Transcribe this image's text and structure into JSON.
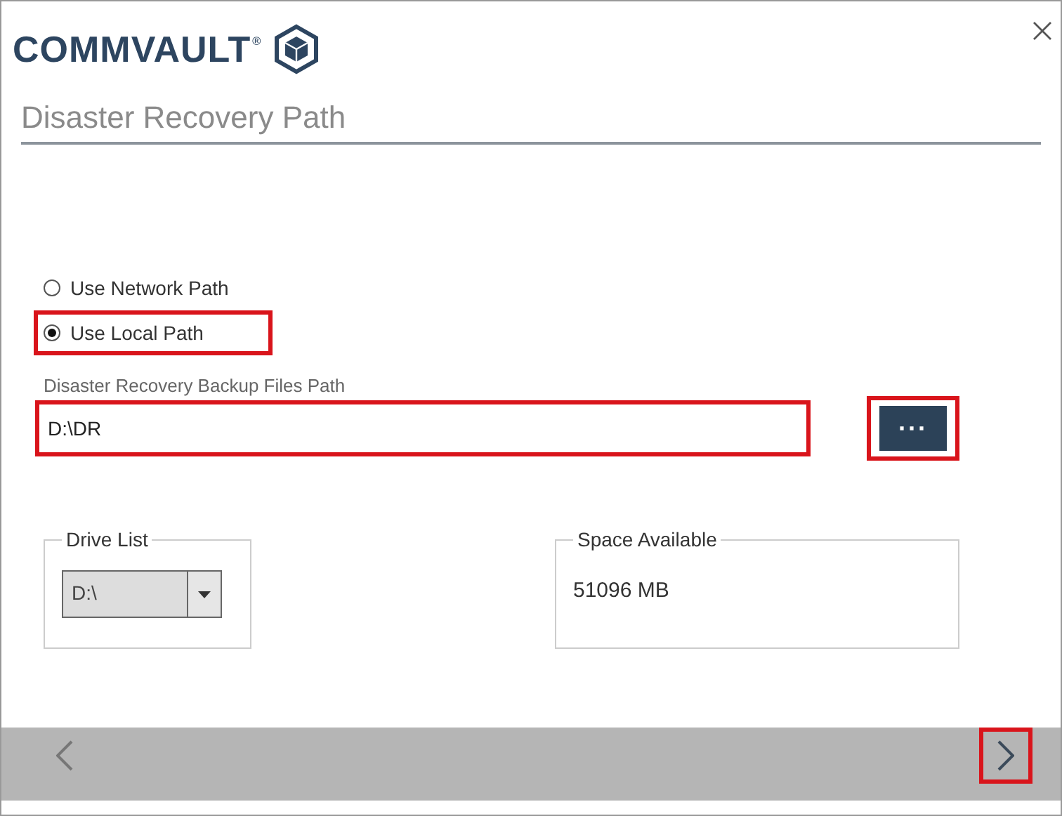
{
  "brand": {
    "name": "COMMVAULT",
    "trademark": "®"
  },
  "page_title": "Disaster Recovery Path",
  "path_options": [
    {
      "label": "Use Network Path",
      "selected": false,
      "highlighted": false
    },
    {
      "label": "Use Local Path",
      "selected": true,
      "highlighted": true
    }
  ],
  "path_field": {
    "label": "Disaster Recovery Backup Files Path",
    "value": "D:\\DR",
    "highlighted": true
  },
  "browse_button": {
    "label": "···",
    "highlighted": true
  },
  "drive_list": {
    "legend": "Drive List",
    "value": "D:\\"
  },
  "space_available": {
    "legend": "Space Available",
    "value": "51096 MB"
  },
  "navigation": {
    "back": {
      "highlighted": false
    },
    "next": {
      "highlighted": true
    }
  }
}
